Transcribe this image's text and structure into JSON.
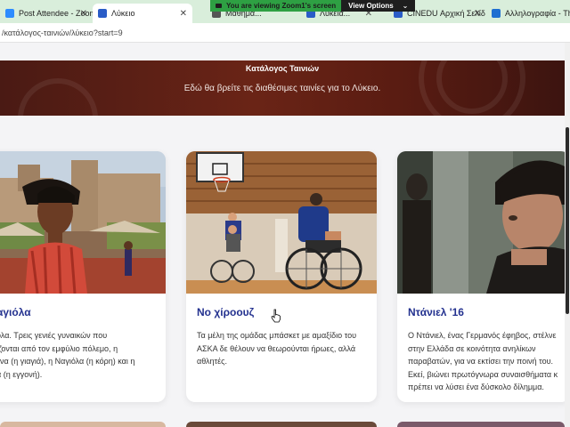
{
  "browser": {
    "tabs": [
      {
        "label": "Post Attendee - Zoom",
        "fav_color": "#2d8cff",
        "active": false
      },
      {
        "label": "Λύκειο",
        "fav_color": "#2a5cc7",
        "active": true
      },
      {
        "label": "Μαθημα...",
        "fav_color": "#555555",
        "active": false
      },
      {
        "label": "Λυκεια...",
        "fav_color": "#2a5cc7",
        "active": false
      },
      {
        "label": "CINEDU Αρχική Σελίδ",
        "fav_color": "#2a5cc7",
        "active": false
      },
      {
        "label": "Αλληλογραφία - Theo",
        "fav_color": "#1f6fd1",
        "active": false
      }
    ],
    "url": "/κατάλογος-ταινιών/λύκειο?start=9"
  },
  "zoom_share": {
    "status": "You are viewing Zoom1's screen",
    "options_label": "View Options",
    "chevron": "chevron-down-icon",
    "close": "close-icon"
  },
  "hero": {
    "title": "Κατάλογος Ταινιών",
    "subtitle": "Εδώ θα βρείτε τις διαθέσιμες ταινίες για το Λύκειο."
  },
  "cards": [
    {
      "title": "αγιόλα",
      "desc_lines": [
        "όλα. Τρεις γενιές γυναικών που",
        "ίζονται από τον εμφύλιο πόλεμο, η",
        "ένα (η γιαγιά), η Ναγιόλα (η κόρη) και η",
        "α (η εγγονή)."
      ]
    },
    {
      "title": "Νο χίρoουζ",
      "desc_lines": [
        "Τα μέλη της ομάδας μπάσκετ με αμαξίδιο του",
        "ΑΣΚΑ δε θέλουν να θεωρούνται ήρωες, αλλά",
        "αθλητές."
      ]
    },
    {
      "title": "Ντάνιελ '16",
      "desc_lines": [
        "Ο Ντάνιελ, ένας Γερμανός έφηβος, στέλνε",
        "στην Ελλάδα σε κοινότητα ανηλίκων",
        "παραβατών, για να εκτίσει την ποινή του.",
        "Εκεί, βιώνει πρωτόγνωρα συναισθήματα κ",
        "πρέπει να λύσει ένα δύσκολο δίλημμα."
      ]
    }
  ],
  "colors": {
    "card_title": "#23318f",
    "hero_bg": "#5a1c12",
    "tabbar_bg": "#d9eedb"
  }
}
